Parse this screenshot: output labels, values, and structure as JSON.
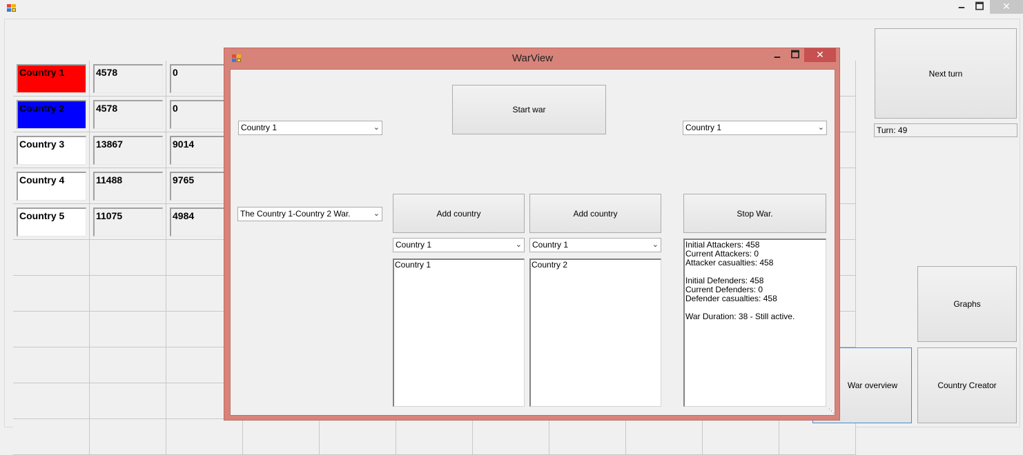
{
  "main_window": {
    "controls": {
      "minimize": "🗕",
      "maximize": "🗖",
      "close": "✕"
    }
  },
  "grid": {
    "rows": [
      {
        "name": "Country 1",
        "value": "4578",
        "extra": "0",
        "color": "#ff0000"
      },
      {
        "name": "Country 2",
        "value": "4578",
        "extra": "0",
        "color": "#0000ff"
      },
      {
        "name": "Country 3",
        "value": "13867",
        "extra": "9014",
        "color": "#ffffff"
      },
      {
        "name": "Country 4",
        "value": "11488",
        "extra": "9765",
        "color": "#ffffff"
      },
      {
        "name": "Country 5",
        "value": "11075",
        "extra": "4984",
        "color": "#ffffff"
      }
    ]
  },
  "side_panel": {
    "next_turn": "Next turn",
    "turn_label": "Turn: 49",
    "graphs": "Graphs",
    "war_overview": "War overview",
    "country_creator": "Country Creator"
  },
  "warview": {
    "title": "WarView",
    "controls": {
      "minimize": "🗕",
      "maximize": "🗖",
      "close": "✕"
    },
    "start_war": "Start war",
    "attacker_select": "Country 1",
    "defender_select": "Country 1",
    "war_select": "The Country 1-Country 2 War.",
    "add_country_left": "Add country",
    "add_country_right": "Add country",
    "stop_war": "Stop War.",
    "left_add_select": "Country 1",
    "right_add_select": "Country 1",
    "left_list": [
      "Country 1"
    ],
    "right_list": [
      "Country 2"
    ],
    "stats": {
      "initial_attackers": "Initial Attackers: 458",
      "current_attackers": "Current Attackers: 0",
      "attacker_casualties": "Attacker casualties: 458",
      "initial_defenders": "Initial Defenders: 458",
      "current_defenders": "Current Defenders: 0",
      "defender_casualties": "Defender casualties: 458",
      "duration": "War Duration: 38 - Still active."
    }
  }
}
